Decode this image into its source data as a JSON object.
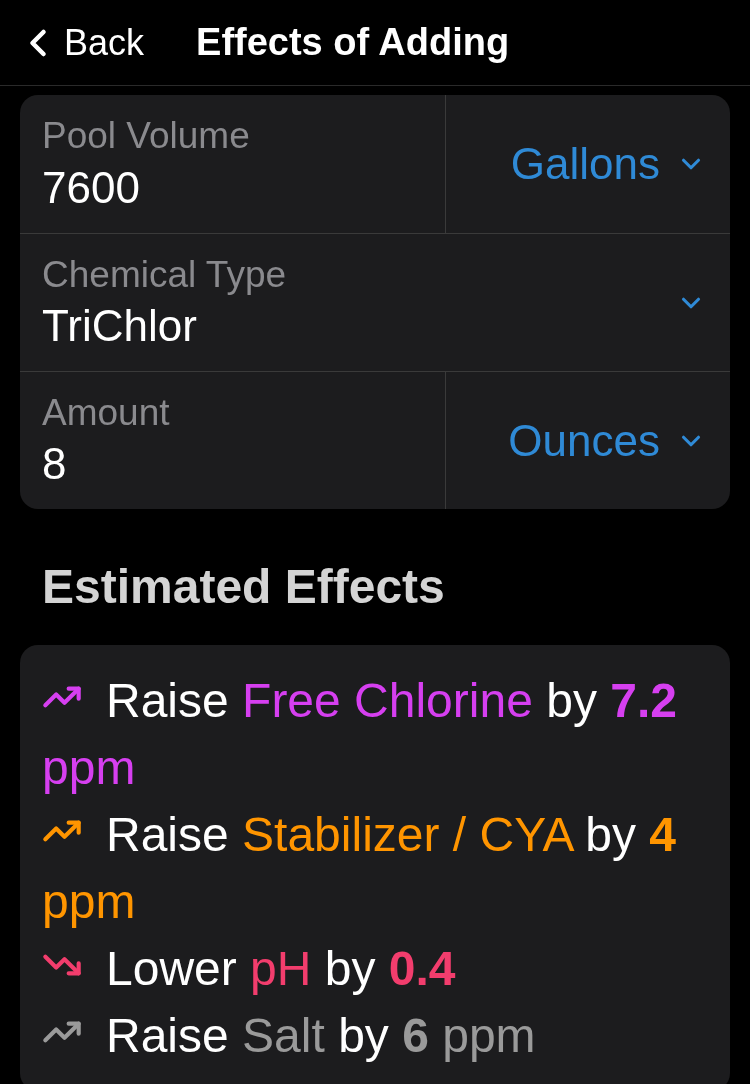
{
  "header": {
    "back": "Back",
    "title": "Effects of Adding"
  },
  "fields": [
    {
      "label": "Pool Volume",
      "value": "7600",
      "unit": "Gallons"
    },
    {
      "label": "Chemical Type",
      "value": "TriChlor"
    },
    {
      "label": "Amount",
      "value": "8",
      "unit": "Ounces"
    }
  ],
  "section_title": "Estimated Effects",
  "effects": [
    {
      "kind": "raise",
      "verb": "Raise",
      "chemical": "Free Chlorine",
      "connector": "by",
      "amount": "7.2",
      "unit": "ppm",
      "color": "#d63ff0"
    },
    {
      "kind": "raise",
      "verb": "Raise",
      "chemical": "Stabilizer / CYA",
      "connector": "by",
      "amount": "4",
      "unit": "ppm",
      "color": "#ff9500"
    },
    {
      "kind": "lower",
      "verb": "Lower",
      "chemical": "pH",
      "connector": "by",
      "amount": "0.4",
      "color": "#f23d6d"
    },
    {
      "kind": "raise",
      "verb": "Raise",
      "chemical": "Salt",
      "connector": "by",
      "amount": "6",
      "unit": "ppm",
      "color": "#9a9a9a"
    }
  ]
}
